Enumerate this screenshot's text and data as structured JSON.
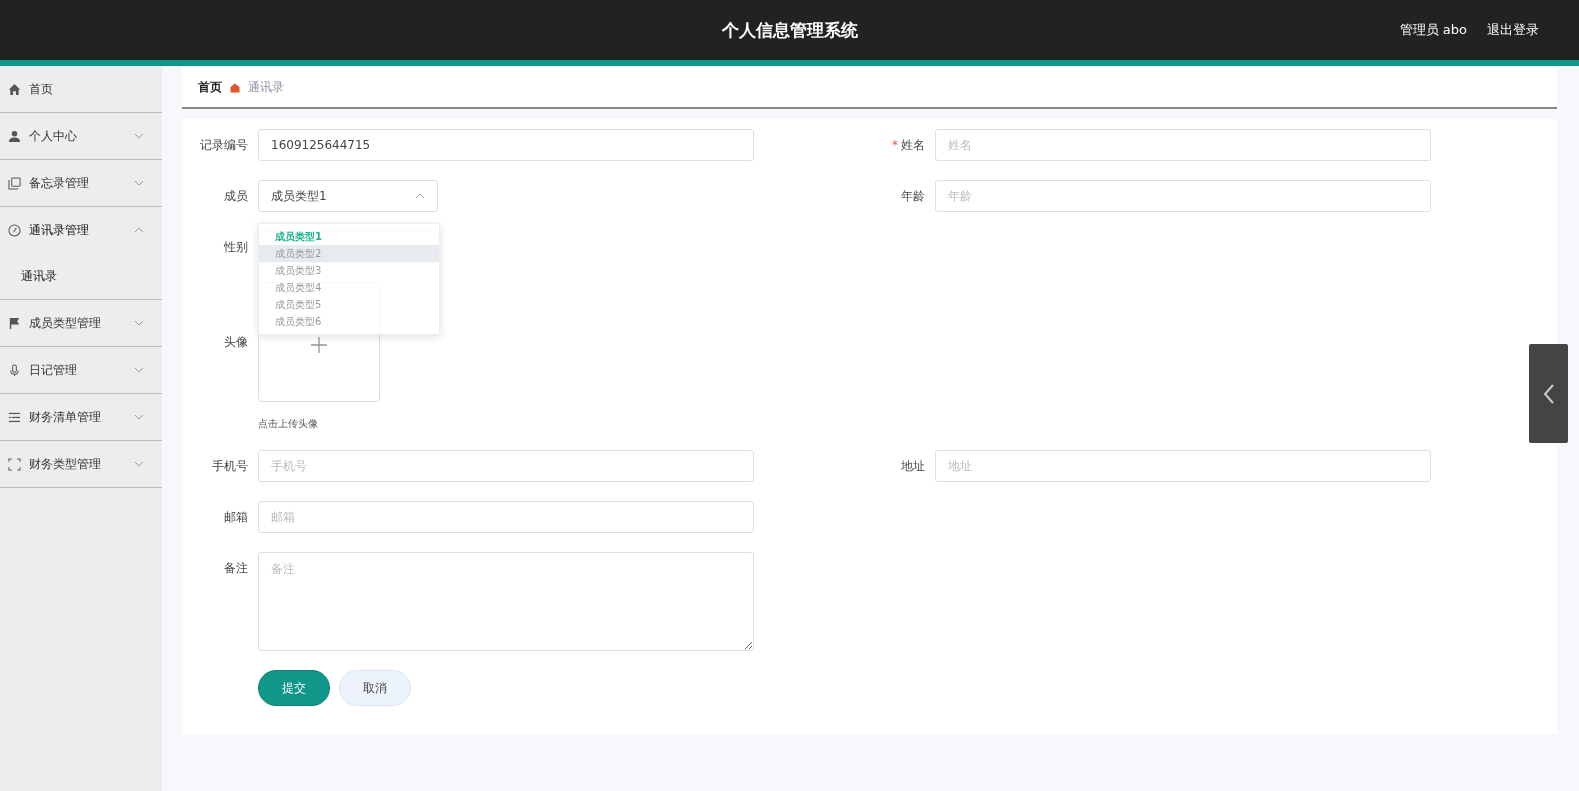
{
  "header": {
    "title": "个人信息管理系统",
    "user": "管理员 abo",
    "logout": "退出登录"
  },
  "sidebar": {
    "items": [
      {
        "label": "首页",
        "kind": "link"
      },
      {
        "label": "个人中心",
        "kind": "menu",
        "expanded": false
      },
      {
        "label": "备忘录管理",
        "kind": "menu",
        "expanded": false
      },
      {
        "label": "通讯录管理",
        "kind": "menu",
        "expanded": true,
        "children": [
          {
            "label": "通讯录"
          }
        ]
      },
      {
        "label": "成员类型管理",
        "kind": "menu",
        "expanded": false
      },
      {
        "label": "日记管理",
        "kind": "menu",
        "expanded": false
      },
      {
        "label": "财务清单管理",
        "kind": "menu",
        "expanded": false
      },
      {
        "label": "财务类型管理",
        "kind": "menu",
        "expanded": false
      }
    ]
  },
  "breadcrumb": [
    {
      "label": "首页",
      "current": false
    },
    {
      "label": "通讯录",
      "current": true
    }
  ],
  "form": {
    "rows": [
      {
        "fields": [
          {
            "kind": "input",
            "label": "记录编号",
            "value": "1609125644715"
          },
          {
            "kind": "input",
            "label": "姓名",
            "placeholder": "姓名",
            "required_mark": "*"
          }
        ]
      },
      {
        "fields": [
          {
            "kind": "select",
            "label": "成员",
            "value": "成员类型1",
            "open": true,
            "options": [
              {
                "label": "成员类型1",
                "selected": true,
                "hovered": false
              },
              {
                "label": "成员类型2",
                "selected": false,
                "hovered": true
              },
              {
                "label": "成员类型3",
                "selected": false,
                "hovered": false
              },
              {
                "label": "成员类型4",
                "selected": false,
                "hovered": false
              },
              {
                "label": "成员类型5",
                "selected": false,
                "hovered": false
              },
              {
                "label": "成员类型6",
                "selected": false,
                "hovered": false
              }
            ]
          },
          {
            "kind": "input",
            "label": "年龄",
            "placeholder": "年龄"
          }
        ]
      },
      {
        "fields": [
          {
            "kind": "select",
            "label": "性别",
            "open": false
          }
        ]
      },
      {
        "fields": [
          {
            "kind": "upload",
            "label": "头像",
            "hint": "点击上传头像"
          }
        ]
      },
      {
        "fields": [
          {
            "kind": "input",
            "label": "手机号",
            "placeholder": "手机号"
          },
          {
            "kind": "input",
            "label": "地址",
            "placeholder": "地址"
          }
        ]
      },
      {
        "fields": [
          {
            "kind": "input",
            "label": "邮箱",
            "placeholder": "邮箱"
          }
        ]
      },
      {
        "fields": [
          {
            "kind": "textarea",
            "label": "备注",
            "placeholder": "备注"
          }
        ]
      }
    ],
    "buttons": [
      {
        "label": "提交",
        "kind": "primary"
      },
      {
        "label": "取消",
        "kind": "default"
      }
    ]
  }
}
